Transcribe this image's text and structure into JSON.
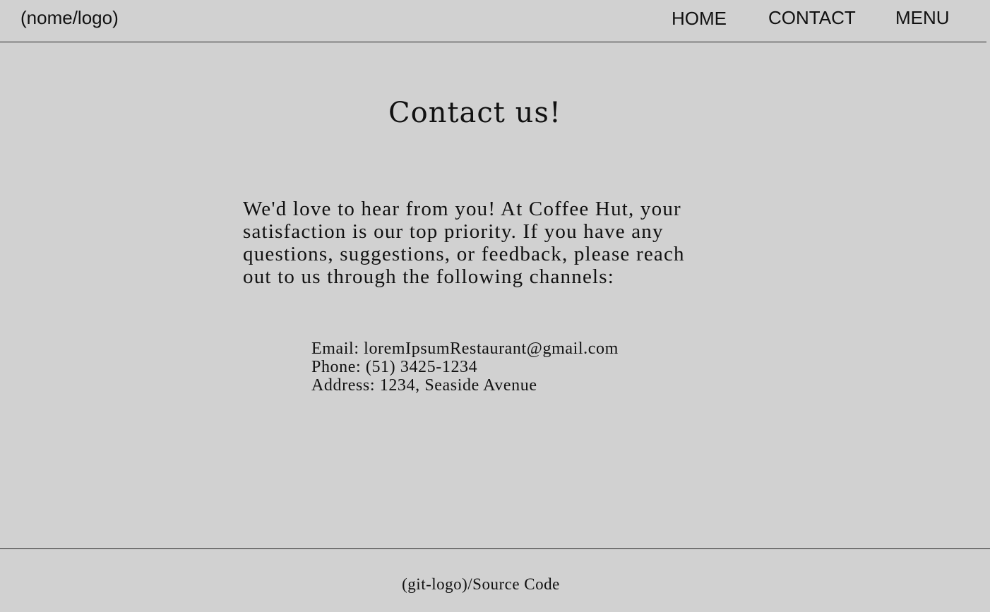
{
  "header": {
    "logo_text": "(nome/logo)",
    "nav": {
      "home": "HOME",
      "contact": "CONTACT",
      "menu": "MENU"
    }
  },
  "main": {
    "title": "Contact us!",
    "intro": "We'd love to hear from you! At Coffee Hut, your satisfaction is our top priority. If you have any questions, suggestions, or feedback, please reach out to us through the following channels:",
    "contact": {
      "email": "Email: loremIpsumRestaurant@gmail.com",
      "phone": "Phone: (51) 3425-1234",
      "address": "Address: 1234, Seaside Avenue"
    }
  },
  "footer": {
    "source_link": "(git-logo)/Source Code"
  },
  "colors": {
    "background": "#d1d1d1",
    "text": "#111111",
    "divider": "#222222"
  }
}
